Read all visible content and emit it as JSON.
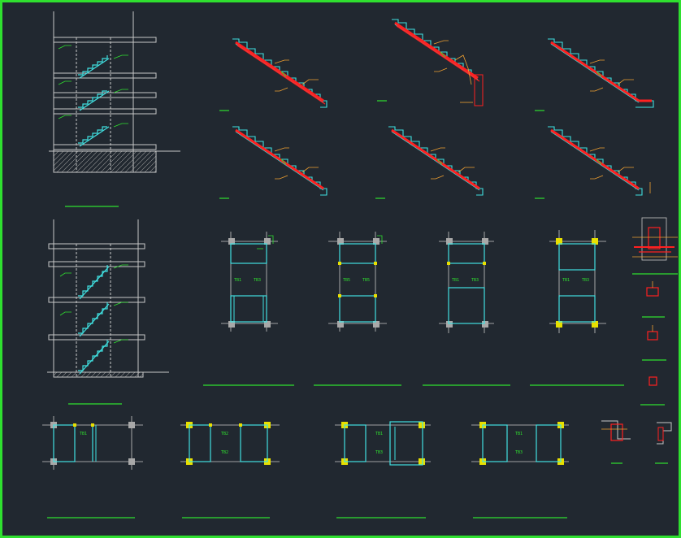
{
  "drawing": {
    "background": "#212830",
    "colors": {
      "frame": "#2fe02f",
      "title_line": "#2fe02f",
      "concrete_outline": "#c8c8c8",
      "stair_rebar": "#ff2020",
      "stair_outline": "#40e0e0",
      "dimension": "#f0a030",
      "annotation": "#2fe02f",
      "column": "#a8a8a8",
      "column_marker": "#e8e000",
      "hatch": "#b0b0b0"
    },
    "beam_labels": {
      "tb1": "TB1",
      "tb2": "TB2",
      "tb3": "TB3",
      "tb5": "TB5"
    }
  }
}
